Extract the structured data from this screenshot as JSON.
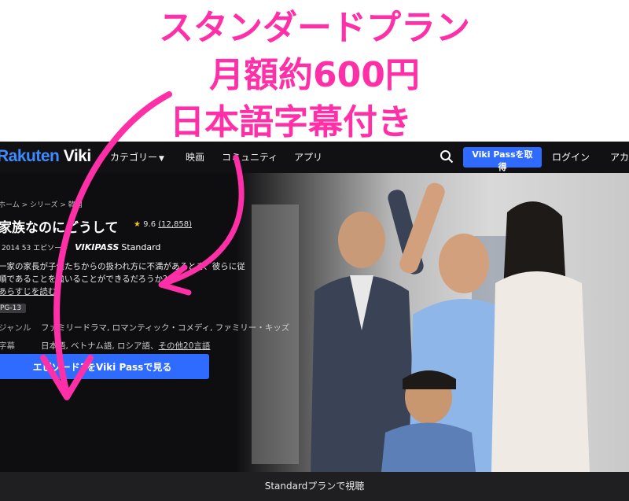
{
  "headline": {
    "line1": "スタンダードプラン",
    "line2": "月額約600円",
    "line3": "日本語字幕付き",
    "color": "#ff2fa8"
  },
  "nav": {
    "logo_prefix": "Rakuten",
    "logo_suffix": "Viki",
    "category": "カテゴリー",
    "movies": "映画",
    "community": "コミュニティ",
    "apps": "アプリ",
    "search_icon": "search-icon",
    "cta": "Viki Passを取得",
    "login": "ログイン",
    "account": "アカ"
  },
  "show": {
    "breadcrumb": "ホーム  >  シリーズ  >  韓国",
    "title": "家族なのにどうして",
    "rating": "9.6",
    "rating_count": "(12,858)",
    "year": "2014",
    "episodes": "53 エピソード",
    "pass": "VIKIPASS",
    "tier": "Standard",
    "description": "一家の家長が子供たちからの扱われ方に不満があるとき、彼らに従順であることを強いることができるだろうか？",
    "more": "あらすじを読む",
    "age_badge": "PG-13",
    "genre_label": "ジャンル",
    "genres": "ファミリードラマ, ロマンティック・コメディ, ファミリー・キッズ",
    "subs_label": "字幕",
    "subs": "日本語, ベトナム語, ロシア語、",
    "subs_more": "その他20言語",
    "watch_button": "エピソード1をViki Passで見る"
  },
  "bottom": {
    "label": "Standardプランで視聴"
  },
  "colors": {
    "accent": "#2f6bff",
    "background": "#0e0e10",
    "pink": "#ff2fa8"
  }
}
